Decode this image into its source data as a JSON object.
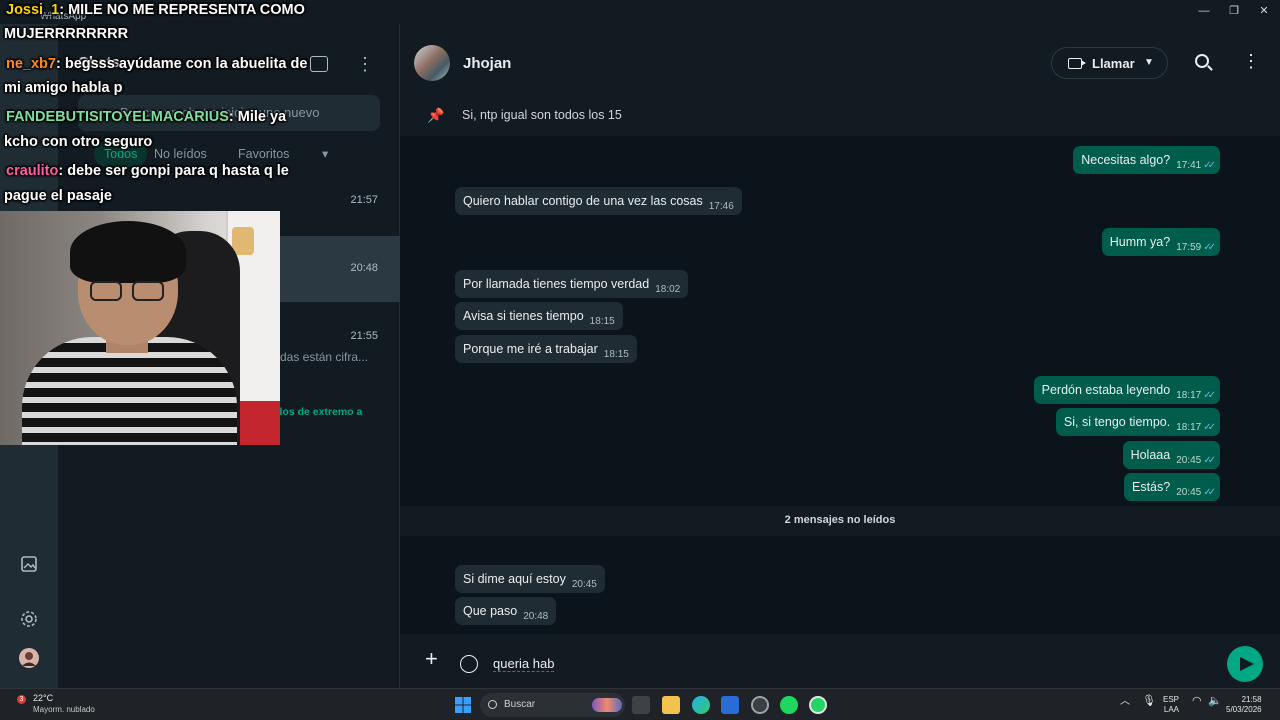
{
  "window": {
    "title": "WhatsApp",
    "controls": [
      "—",
      "❐",
      "✕"
    ]
  },
  "chat_list": {
    "title": "Chats",
    "search_placeholder": "Buscar un chat o iniciar uno nuevo",
    "filters": [
      "Todos",
      "No leídos",
      "Favoritos"
    ],
    "rows": [
      {
        "time": "21:57",
        "snippet": ""
      },
      {
        "time": "20:48",
        "snippet": ""
      },
      {
        "time": "21:55",
        "snippet": "das están cifra..."
      }
    ],
    "encryption_note": "dos de extremo a"
  },
  "chat": {
    "contact_name": "Jhojan",
    "call_label": "Llamar",
    "pinned_message": "Si, ntp igual son todos los 15",
    "messages": [
      {
        "dir": "out",
        "text": "Necesitas algo?",
        "time": "17:41"
      },
      {
        "dir": "in",
        "text": "Quiero hablar contigo de una vez las cosas",
        "time": "17:46"
      },
      {
        "dir": "out",
        "text": "Humm ya?",
        "time": "17:59"
      },
      {
        "dir": "in",
        "text": "Por llamada tienes tiempo verdad",
        "time": "18:02"
      },
      {
        "dir": "in",
        "text": "Avisa si tienes tiempo",
        "time": "18:15"
      },
      {
        "dir": "in",
        "text": "Porque me iré a trabajar",
        "time": "18:15"
      },
      {
        "dir": "out",
        "text": "Perdón estaba leyendo",
        "time": "18:17"
      },
      {
        "dir": "out",
        "text": "Si, si tengo tiempo.",
        "time": "18:17"
      },
      {
        "dir": "out",
        "text": "Holaaa",
        "time": "20:45"
      },
      {
        "dir": "out",
        "text": "Estás?",
        "time": "20:45"
      },
      {
        "dir": "in",
        "text": "Si dime aquí estoy",
        "time": "20:45"
      },
      {
        "dir": "in",
        "text": "Que paso",
        "time": "20:48"
      }
    ],
    "unread_banner": "2 mensajes no leídos",
    "composer_text": "queria hab"
  },
  "stream_chat": [
    {
      "user": "Jossi_1",
      "user_color": "#ffd400",
      "text": ": MILE NO ME REPRESENTA COMO"
    },
    {
      "user": "",
      "user_color": "#ffffff",
      "text": "MUJERRRRRRRR"
    },
    {
      "user": "ne_xb7",
      "user_color": "#ff8c1a",
      "text": ": begsss ayúdame con la abuelita de"
    },
    {
      "user": "",
      "user_color": "#ffffff",
      "text": "mi amigo habla p"
    },
    {
      "user": "FANDEBUTISITOYELMACARIUS",
      "user_color": "#7ee0a0",
      "text": ": Mile ya"
    },
    {
      "user": "",
      "user_color": "#ffffff",
      "text": "kcho con otro seguro"
    },
    {
      "user": "craulito",
      "user_color": "#ff5fa2",
      "text": ": debe ser gonpi para q hasta q le"
    },
    {
      "user": "",
      "user_color": "#ffffff",
      "text": "pague el pasaje"
    }
  ],
  "taskbar": {
    "temperature": "22°C",
    "weather": "Mayorm. nublado",
    "weather_badge": "3",
    "search_label": "Buscar",
    "lang_top": "ESP",
    "lang_bottom": "LAA",
    "time": "21:58",
    "date": "5/03/2026"
  },
  "colors": {
    "accent": "#00a884",
    "outgoing": "#005c4b",
    "incoming": "#202c33",
    "background": "#0b141a"
  }
}
